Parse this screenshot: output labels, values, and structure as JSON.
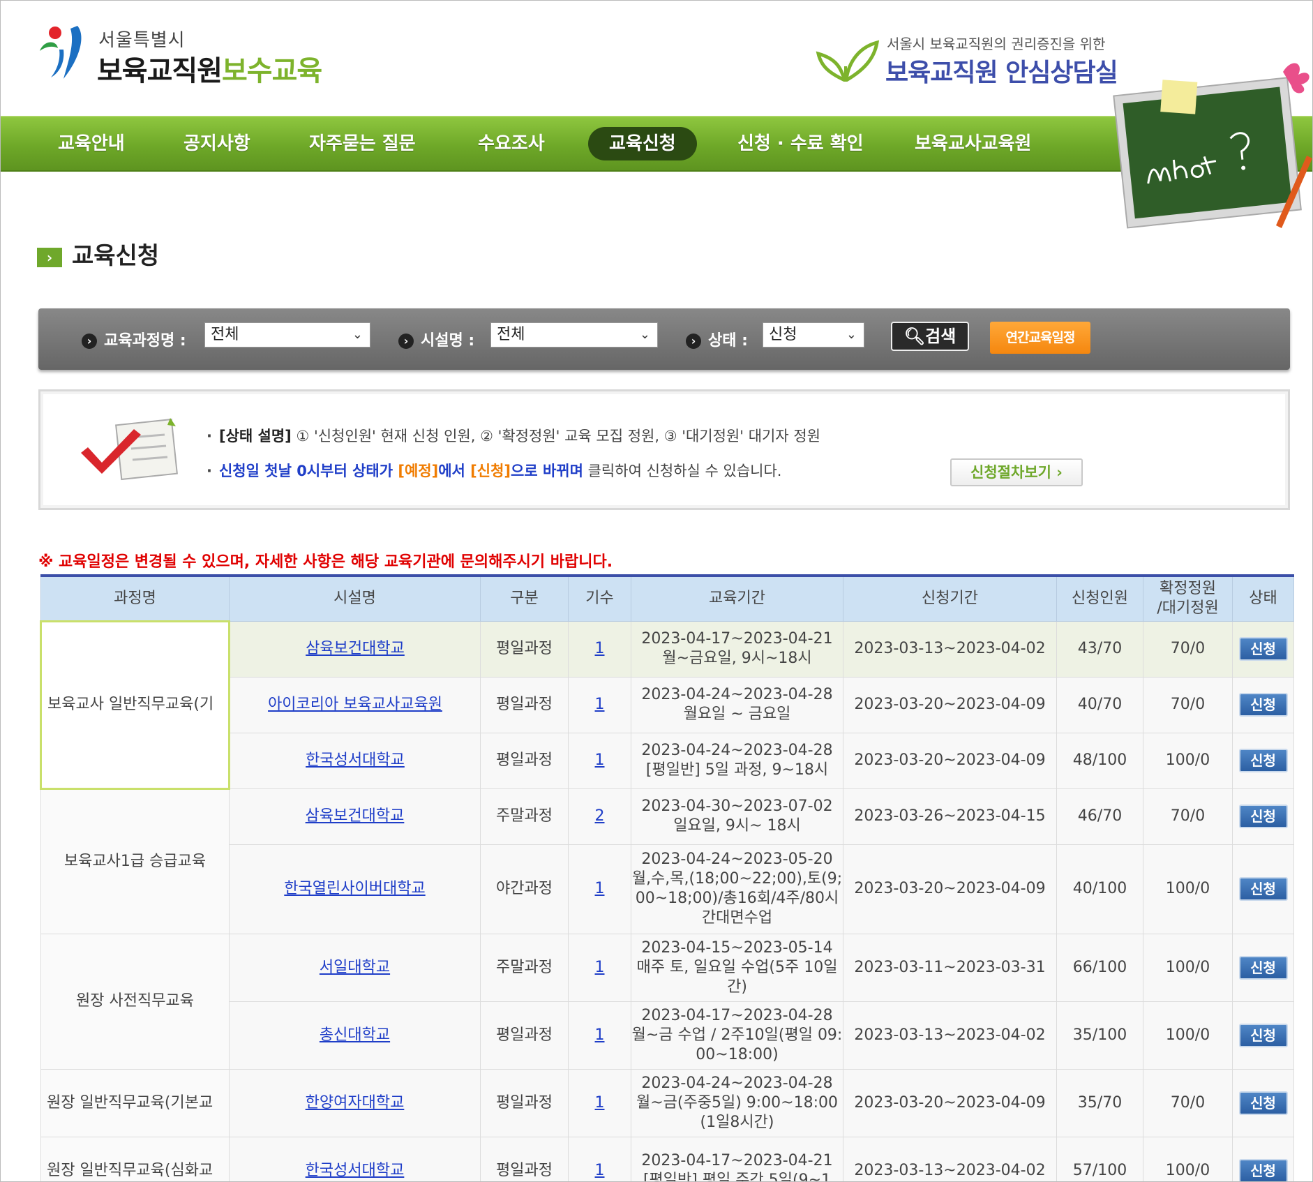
{
  "header": {
    "logo_sub": "서울특별시",
    "logo_main_dark": "보육교직원",
    "logo_main_green": "보수교육",
    "counsel_sub": "서울시 보육교직원의 권리증진을 위한",
    "counsel_main": "보육교직원 안심상담실"
  },
  "nav": {
    "items": [
      "교육안내",
      "공지사항",
      "자주묻는 질문",
      "수요조사",
      "교육신청",
      "신청 · 수료 확인",
      "보육교사교육원"
    ],
    "active_index": 4
  },
  "page_title": "교육신청",
  "search": {
    "course_label": "교육과정명 :",
    "course_value": "전체",
    "facility_label": "시설명 :",
    "facility_value": "전체",
    "status_label": "상태 :",
    "status_value": "신청",
    "search_button": "검색",
    "annual_button": "연간교육일정"
  },
  "info": {
    "line1_head": "[상태 설명]",
    "line1_text": " ① '신청인원' 현재 신청 인원, ② '확정정원' 교육 모집 정원, ③ '대기정원' 대기자 정원",
    "line2_a": "신청일 첫날 0시부터 상태가 ",
    "line2_b": "[예정]",
    "line2_c": "에서 ",
    "line2_d": "[신청]",
    "line2_e": "으로 바뀌며",
    "line2_f": " 클릭하여 신청하실 수 있습니다.",
    "procedure_button": "신청절차보기 ›"
  },
  "notice": "※ 교육일정은 변경될 수 있으며, 자세한 사항은 해당 교육기관에 문의해주시기 바랍니다.",
  "table": {
    "headers": {
      "course": "과정명",
      "facility": "시설명",
      "type": "구분",
      "term": "기수",
      "period": "교육기간",
      "apply_period": "신청기간",
      "applicants": "신청인원",
      "capacity_1": "확정정원",
      "capacity_2": "/대기정원",
      "status": "상태"
    },
    "courses": [
      "보육교사 일반직무교육(기",
      "보육교사1급 승급교육",
      "원장 사전직무교육",
      "원장 일반직무교육(기본교",
      "원장 일반직무교육(심화교"
    ],
    "rows": [
      {
        "facility": "삼육보건대학교",
        "type": "평일과정",
        "term": "1",
        "period_1": "2023-04-17~2023-04-21",
        "period_2": "월~금요일, 9시~18시",
        "apply_period": "2023-03-13~2023-04-02",
        "applicants": "43/70",
        "capacity": "70/0",
        "status": "신청"
      },
      {
        "facility": "아이코리아 보육교사교육원",
        "type": "평일과정",
        "term": "1",
        "period_1": "2023-04-24~2023-04-28",
        "period_2": "월요일 ~ 금요일",
        "apply_period": "2023-03-20~2023-04-09",
        "applicants": "40/70",
        "capacity": "70/0",
        "status": "신청"
      },
      {
        "facility": "한국성서대학교",
        "type": "평일과정",
        "term": "1",
        "period_1": "2023-04-24~2023-04-28",
        "period_2": "[평일반] 5일 과정, 9~18시",
        "apply_period": "2023-03-20~2023-04-09",
        "applicants": "48/100",
        "capacity": "100/0",
        "status": "신청"
      },
      {
        "facility": "삼육보건대학교",
        "type": "주말과정",
        "term": "2",
        "period_1": "2023-04-30~2023-07-02",
        "period_2": "일요일, 9시~ 18시",
        "apply_period": "2023-03-26~2023-04-15",
        "applicants": "46/70",
        "capacity": "70/0",
        "status": "신청"
      },
      {
        "facility": "한국열린사이버대학교",
        "type": "야간과정",
        "term": "1",
        "period_1": "2023-04-24~2023-05-20",
        "period_2": "월,수,목,(18;00~22;00),토(9;00~18;00)/총16회/4주/80시간대면수업",
        "apply_period": "2023-03-20~2023-04-09",
        "applicants": "40/100",
        "capacity": "100/0",
        "status": "신청"
      },
      {
        "facility": "서일대학교",
        "type": "주말과정",
        "term": "1",
        "period_1": "2023-04-15~2023-05-14",
        "period_2": "매주 토, 일요일 수업(5주 10일간)",
        "apply_period": "2023-03-11~2023-03-31",
        "applicants": "66/100",
        "capacity": "100/0",
        "status": "신청"
      },
      {
        "facility": "총신대학교",
        "type": "평일과정",
        "term": "1",
        "period_1": "2023-04-17~2023-04-28",
        "period_2": "월~금 수업 / 2주10일(평일 09:00~18:00)",
        "apply_period": "2023-03-13~2023-04-02",
        "applicants": "35/100",
        "capacity": "100/0",
        "status": "신청"
      },
      {
        "facility": "한양여자대학교",
        "type": "평일과정",
        "term": "1",
        "period_1": "2023-04-24~2023-04-28",
        "period_2": "월~금(주중5일) 9:00~18:00(1일8시간)",
        "apply_period": "2023-03-20~2023-04-09",
        "applicants": "35/70",
        "capacity": "70/0",
        "status": "신청"
      },
      {
        "facility": "한국성서대학교",
        "type": "평일과정",
        "term": "1",
        "period_1": "2023-04-17~2023-04-21",
        "period_2": "[평일반] 평일 주간 5일(9~1",
        "apply_period": "2023-03-13~2023-04-02",
        "applicants": "57/100",
        "capacity": "100/0",
        "status": "신청"
      }
    ]
  },
  "colors": {
    "nav_green": "#6ea828",
    "nav_active": "#2b4a12",
    "link_blue": "#1f3ec8",
    "notice_red": "#e00000",
    "header_blue": "#cde1f3",
    "accent_orange": "#f5870f"
  },
  "icons": [
    "seoul-logo-icon",
    "leaf-icon",
    "chalkboard-icon",
    "arrow-icon",
    "search-icon",
    "checklist-icon",
    "chevron-down-icon"
  ]
}
